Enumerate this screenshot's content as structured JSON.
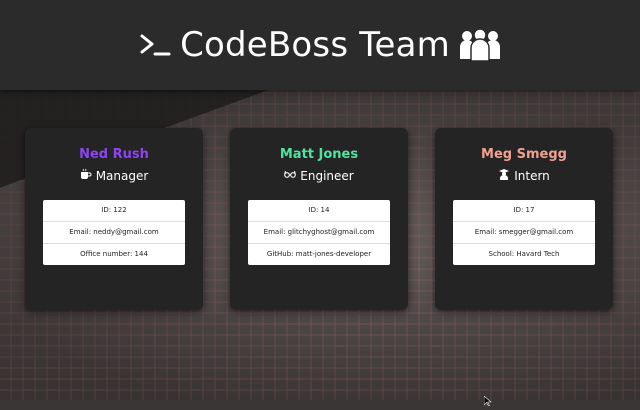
{
  "header": {
    "title": "CodeBoss Team",
    "left_icon": "terminal-prompt-icon",
    "right_icon": "team-icon"
  },
  "colors": {
    "header_bg": "#2b2b2b",
    "card_bg": "#242424",
    "manager_name": "#8e44f0",
    "engineer_name": "#4fe3a0",
    "intern_name": "#f0a090"
  },
  "employees": [
    {
      "name": "Ned Rush",
      "role": "Manager",
      "role_icon": "coffee-mug-icon",
      "details": [
        "ID: 122",
        "Email: neddy@gmail.com",
        "Office number: 144"
      ]
    },
    {
      "name": "Matt Jones",
      "role": "Engineer",
      "role_icon": "glasses-icon",
      "details": [
        "ID: 14",
        "Email: glitchyghost@gmail.com",
        "GitHub: matt-jones-developer"
      ]
    },
    {
      "name": "Meg Smegg",
      "role": "Intern",
      "role_icon": "graduate-icon",
      "details": [
        "ID: 17",
        "Email: smegger@gmail.com",
        "School: Havard Tech"
      ]
    }
  ]
}
